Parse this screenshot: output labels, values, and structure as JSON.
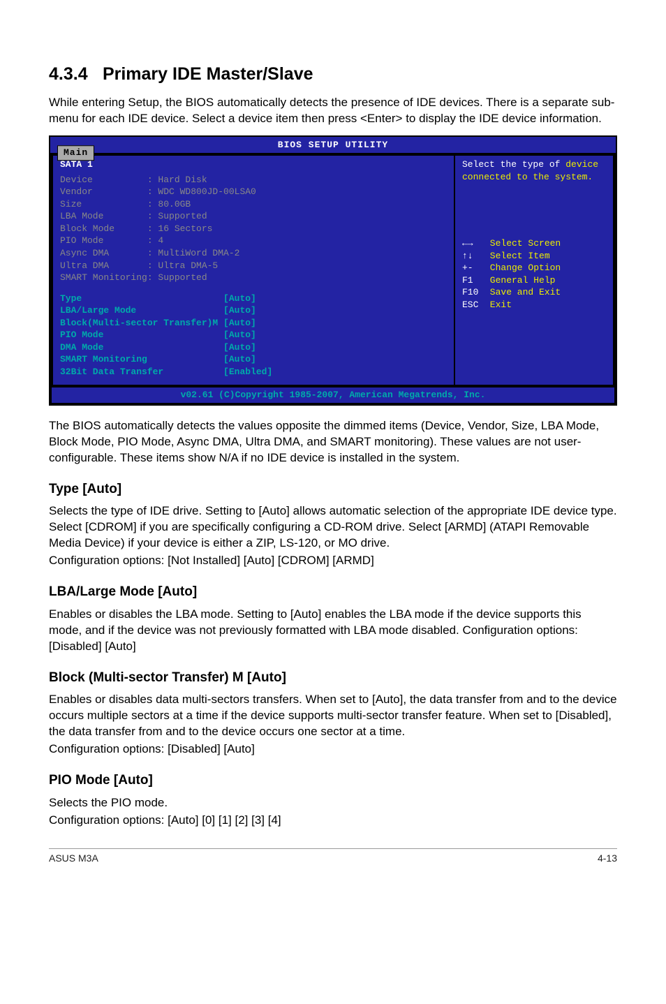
{
  "section": {
    "number": "4.3.4",
    "title": "Primary IDE Master/Slave"
  },
  "intro": "While entering Setup, the BIOS automatically detects the presence of IDE devices. There is a separate sub-menu for each IDE device. Select a device item then press <Enter> to display the IDE device information.",
  "bios": {
    "title": "BIOS SETUP UTILITY",
    "tab": "Main",
    "sata": "SATA 1",
    "detected": [
      {
        "label": "Device",
        "value": "Hard Disk"
      },
      {
        "label": "Vendor",
        "value": "WDC WD800JD-00LSA0"
      },
      {
        "label": "Size",
        "value": "80.0GB"
      },
      {
        "label": "LBA Mode",
        "value": "Supported"
      },
      {
        "label": "Block Mode",
        "value": "16 Sectors"
      },
      {
        "label": "PIO Mode",
        "value": "4"
      },
      {
        "label": "Async DMA",
        "value": "MultiWord DMA-2"
      },
      {
        "label": "Ultra DMA",
        "value": "Ultra DMA-5"
      },
      {
        "label": "SMART Monitoring",
        "value": "Supported"
      }
    ],
    "settings": [
      {
        "label": "Type",
        "value": "[Auto]"
      },
      {
        "label": "LBA/Large Mode",
        "value": "[Auto]"
      },
      {
        "label": "Block(Multi-sector Transfer)M",
        "value": "[Auto]"
      },
      {
        "label": "PIO Mode",
        "value": "[Auto]"
      },
      {
        "label": "DMA Mode",
        "value": "[Auto]"
      },
      {
        "label": "SMART Monitoring",
        "value": "[Auto]"
      },
      {
        "label": "32Bit Data Transfer",
        "value": "[Enabled]"
      }
    ],
    "help_top": "Select the type of device connected to the system.",
    "legend": [
      {
        "key": "←→",
        "text": "Select Screen"
      },
      {
        "key": "↑↓",
        "text": "Select Item"
      },
      {
        "key": "+-",
        "text": "Change Option"
      },
      {
        "key": "F1",
        "text": "General Help"
      },
      {
        "key": "F10",
        "text": "Save and Exit"
      },
      {
        "key": "ESC",
        "text": "Exit"
      }
    ],
    "copyright": "v02.61 (C)Copyright 1985-2007, American Megatrends, Inc."
  },
  "para_after_bios": "The BIOS automatically detects the values opposite the dimmed items (Device, Vendor, Size, LBA Mode, Block Mode, PIO Mode, Async DMA, Ultra DMA, and SMART monitoring). These values are not user-configurable. These items show N/A if no IDE device is installed in the system.",
  "type_h": "Type [Auto]",
  "type_p": "Selects the type of IDE drive. Setting to [Auto] allows automatic selection of the appropriate IDE device type. Select [CDROM] if you are specifically configuring a CD-ROM drive. Select [ARMD] (ATAPI Removable Media Device) if your device is either a ZIP, LS-120, or MO drive.",
  "type_cfg": "Configuration options: [Not Installed] [Auto] [CDROM] [ARMD]",
  "lba_h": "LBA/Large Mode [Auto]",
  "lba_p": "Enables or disables the LBA mode. Setting to [Auto] enables the LBA mode if the device supports this mode, and if the device was not previously formatted with LBA mode disabled. Configuration options: [Disabled] [Auto]",
  "block_h": "Block (Multi-sector Transfer) M [Auto]",
  "block_p": "Enables or disables data multi-sectors transfers. When set to [Auto], the data transfer from and to the device occurs multiple sectors at a time if the device supports multi-sector transfer feature. When set to [Disabled], the data transfer from and to the device occurs one sector at a time.",
  "block_cfg": "Configuration options: [Disabled] [Auto]",
  "pio_h": "PIO Mode [Auto]",
  "pio_p1": "Selects the PIO mode.",
  "pio_cfg": "Configuration options: [Auto] [0] [1] [2] [3] [4]",
  "footer_left": "ASUS M3A",
  "footer_right": "4-13"
}
